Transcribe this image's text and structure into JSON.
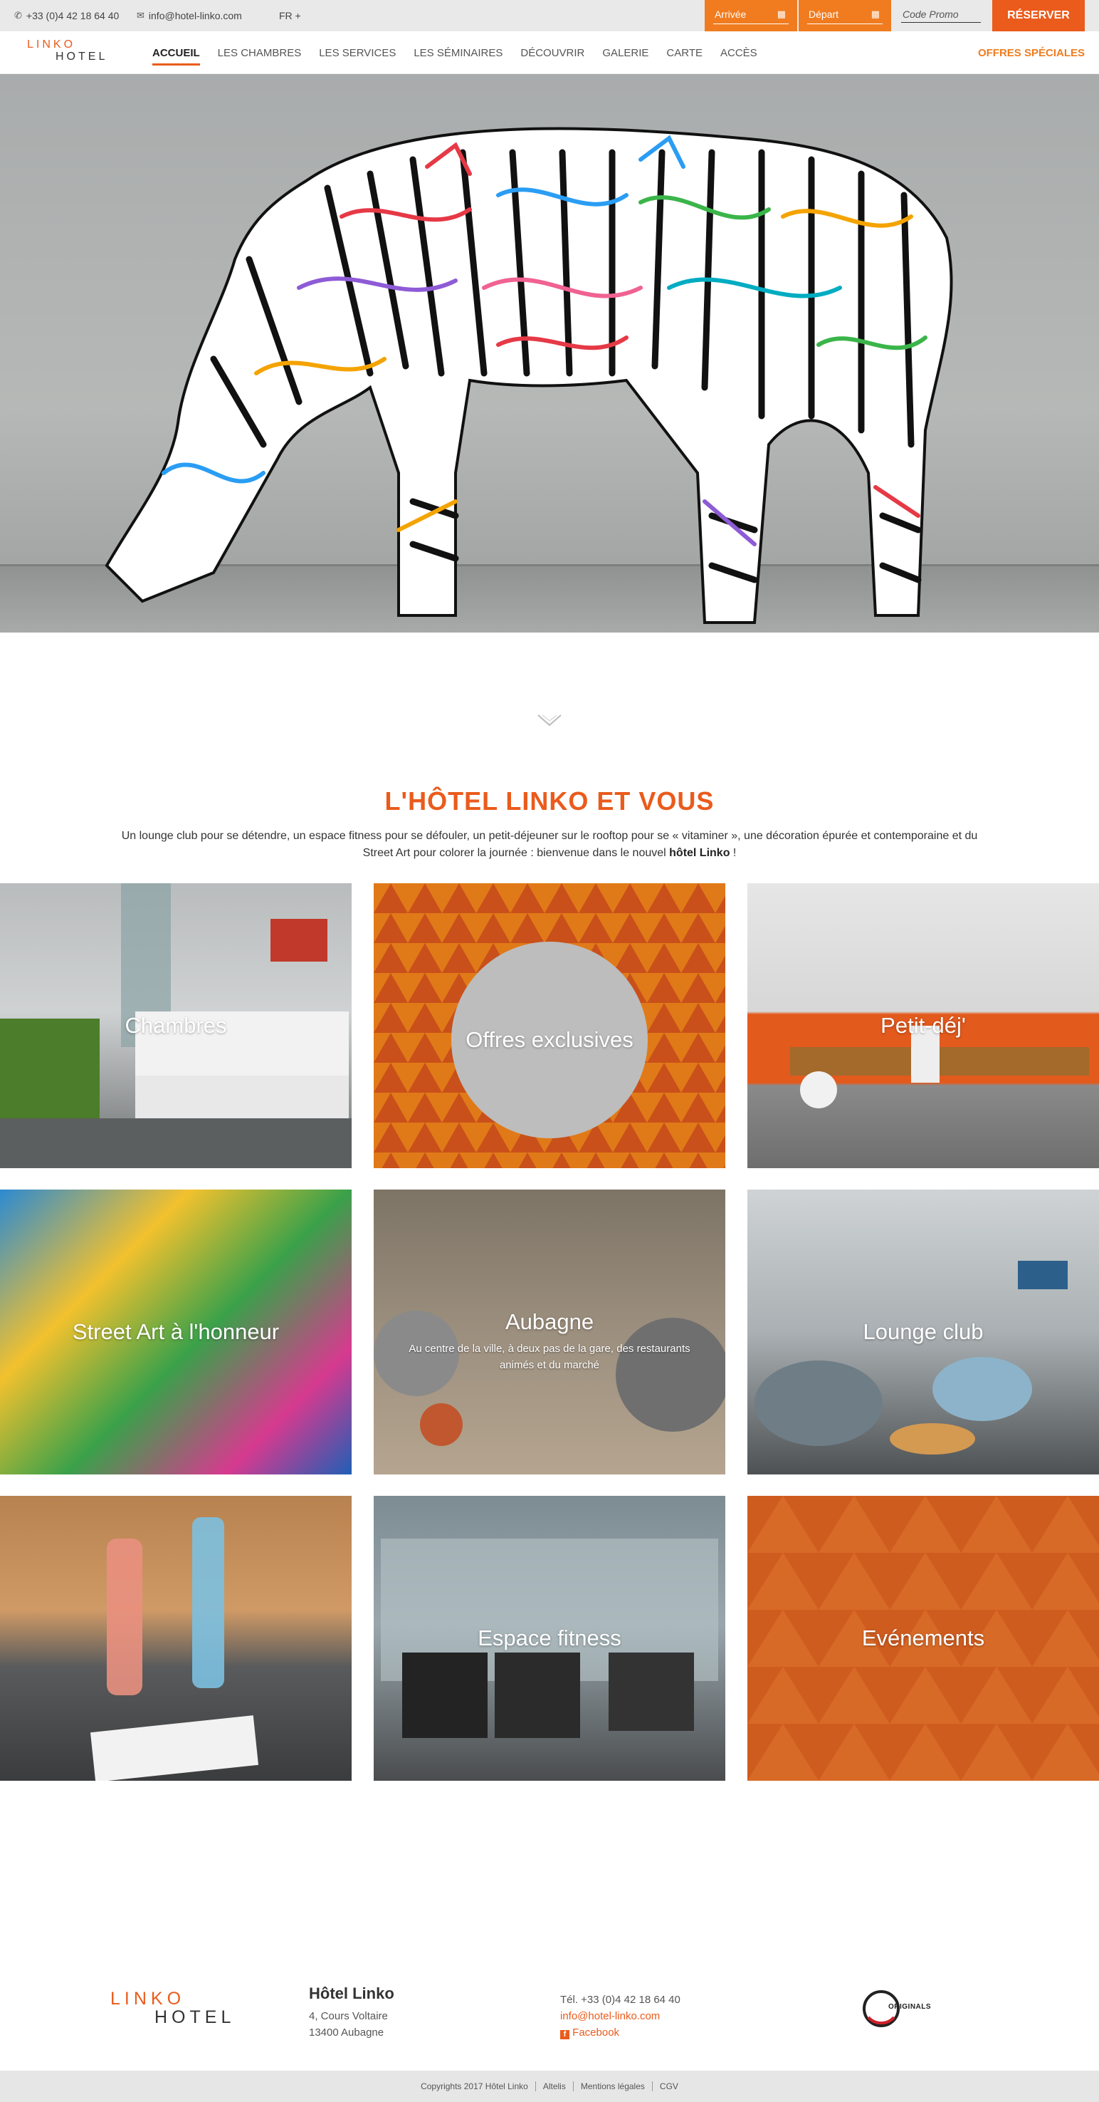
{
  "topbar": {
    "phone": "+33 (0)4 42 18 64 40",
    "email": "info@hotel-linko.com",
    "language": "FR +",
    "arrival_label": "Arrivée",
    "departure_label": "Départ",
    "promo_placeholder": "Code Promo",
    "reserve_label": "RÉSERVER"
  },
  "nav": {
    "logo_line1": "LINKO",
    "logo_line2": "HOTEL",
    "items": [
      "ACCUEIL",
      "LES CHAMBRES",
      "LES SERVICES",
      "LES SÉMINAIRES",
      "DÉCOUVRIR",
      "GALERIE",
      "CARTE",
      "ACCÈS"
    ],
    "active": "ACCUEIL",
    "special_offers": "OFFRES SPÉCIALES"
  },
  "intro": {
    "title": "L'HÔTEL LINKO ET VOUS",
    "text_before": "Un lounge club pour se détendre, un espace fitness pour se défouler, un petit-déjeuner sur le rooftop pour se « vitaminer », une décoration épurée et contemporaine et du Street Art pour colorer la journée : bienvenue dans le nouvel ",
    "text_bold": "hôtel Linko",
    "text_after": " !"
  },
  "tiles": [
    {
      "title": "Chambres"
    },
    {
      "title": "Offres exclusives"
    },
    {
      "title": "Petit-déj'"
    },
    {
      "title": "Street Art à l'honneur"
    },
    {
      "title": "Aubagne",
      "subtitle": "Au centre de la ville, à deux pas de la gare, des restaurants animés et du marché"
    },
    {
      "title": "Lounge club"
    },
    {
      "title": ""
    },
    {
      "title": "Espace fitness"
    },
    {
      "title": "Evénements"
    }
  ],
  "footer": {
    "logo_line1": "LINKO",
    "logo_line2": "HOTEL",
    "hotel_name": "Hôtel Linko",
    "address_line1": "4, Cours Voltaire",
    "address_line2": "13400 Aubagne",
    "phone": "Tél. +33 (0)4 42 18 64 40",
    "email": "info@hotel-linko.com",
    "facebook": "Facebook",
    "partner_logo_text": "ORIGINALS",
    "copyright": "Copyrights 2017 Hôtel Linko",
    "links": [
      "Altelis",
      "Mentions légales",
      "CGV"
    ]
  },
  "colors": {
    "accent": "#ea5b1c",
    "accent_light": "#f07c1f",
    "topbar_bg": "#e9e9e9"
  },
  "icons": {
    "phone": "phone-icon",
    "email": "envelope-icon",
    "calendar": "calendar-icon",
    "scroll": "chevron-down-icon",
    "facebook": "facebook-icon"
  }
}
